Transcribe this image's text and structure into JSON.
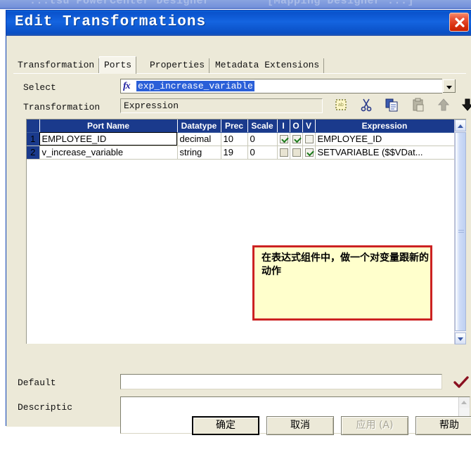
{
  "app_window": {
    "title_left": "...tsu PowerCenter Designer",
    "title_right": "[Mapping Designer ...]"
  },
  "dialog": {
    "title": "Edit Transformations",
    "close_icon": "close-icon"
  },
  "tabs": [
    {
      "label": "Transformation",
      "active": false
    },
    {
      "label": "Ports",
      "active": true
    },
    {
      "label": "Properties",
      "active": false
    },
    {
      "label": "Metadata Extensions",
      "active": false
    }
  ],
  "select_row": {
    "label": "Select",
    "fx_icon": "fx-icon",
    "value": "exp_increase_variable",
    "dropdown_icon": "chevron-down-icon"
  },
  "transformation_row": {
    "label": "Transformation",
    "value": "Expression"
  },
  "toolbar_icons": [
    {
      "name": "new-port-icon",
      "enabled": true
    },
    {
      "name": "cut-icon",
      "enabled": true
    },
    {
      "name": "copy-icon",
      "enabled": true
    },
    {
      "name": "paste-icon",
      "enabled": false
    },
    {
      "name": "move-up-icon",
      "enabled": false
    },
    {
      "name": "move-down-icon",
      "enabled": true
    }
  ],
  "grid": {
    "columns": [
      "",
      "Port Name",
      "Datatype",
      "Prec",
      "Scale",
      "I",
      "O",
      "V",
      "Expression"
    ],
    "rows": [
      {
        "num": "1",
        "port_name": "EMPLOYEE_ID",
        "datatype": "decimal",
        "prec": "10",
        "scale": "0",
        "i": true,
        "o": true,
        "v": false,
        "expression": "EMPLOYEE_ID",
        "expression_dim": true,
        "scale_dim": false,
        "selected": true
      },
      {
        "num": "2",
        "port_name": "v_increase_variable",
        "datatype": "string",
        "prec": "19",
        "scale": "0",
        "i": false,
        "o": false,
        "v": true,
        "expression": "SETVARIABLE ($$VDat...",
        "expression_dim": false,
        "scale_dim": true,
        "selected": false
      }
    ],
    "scrollbar": {
      "up_icon": "scroll-up-icon",
      "down_icon": "scroll-down-icon"
    }
  },
  "note": {
    "text": "在表达式组件中，做一个对变量跟新的动作",
    "background": "#ffffcc",
    "border_color": "#cc2222"
  },
  "default_field": {
    "label": "Default",
    "value": "",
    "placeholder": "",
    "confirm_icon": "checkmark-icon"
  },
  "description_field": {
    "label": "Descriptic",
    "value": "",
    "placeholder": ""
  },
  "buttons": [
    {
      "label": "确定",
      "state": "default"
    },
    {
      "label": "取消",
      "state": "normal"
    },
    {
      "label": "应用 (A)",
      "state": "disabled"
    },
    {
      "label": "帮助",
      "state": "normal"
    }
  ],
  "colors": {
    "titlebar": "#0a52cc",
    "dialog_face": "#ece9d8",
    "grid_header": "#1a3a8c",
    "selection": "#2a5fd8",
    "note_bg": "#ffffcc",
    "note_border": "#cc2222"
  }
}
